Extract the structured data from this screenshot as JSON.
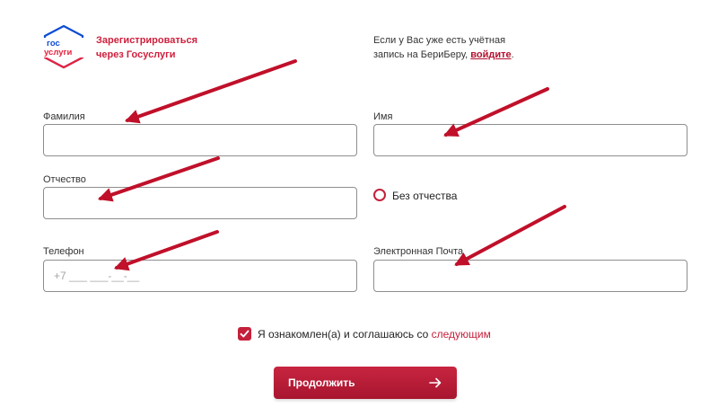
{
  "gosuslugi": {
    "logo_line1": "гос",
    "logo_line2": "услуги",
    "link_line1": "Зарегистрироваться",
    "link_line2": "через Госуслуги"
  },
  "login_note": {
    "line1": "Если у Вас уже есть учётная",
    "line2_prefix": "запись на БериБеру, ",
    "link": "войдите",
    "suffix": "."
  },
  "form": {
    "last_name": {
      "label": "Фамилия",
      "value": ""
    },
    "first_name": {
      "label": "Имя",
      "value": ""
    },
    "middle_name": {
      "label": "Отчество",
      "value": ""
    },
    "no_middle_name": {
      "label": "Без отчества",
      "checked": false
    },
    "phone": {
      "label": "Телефон",
      "placeholder": "+7 ___ ___-__-__"
    },
    "email": {
      "label": "Электронная Почта",
      "value": ""
    }
  },
  "consent": {
    "checked": true,
    "text": "Я ознакомлен(а) и соглашаюсь со ",
    "link": "следующим"
  },
  "continue_button": {
    "label": "Продолжить"
  },
  "colors": {
    "brand_red": "#c4203b",
    "gosuslugi_blue": "#0d4cd3",
    "arrow_red": "#c0102a"
  }
}
